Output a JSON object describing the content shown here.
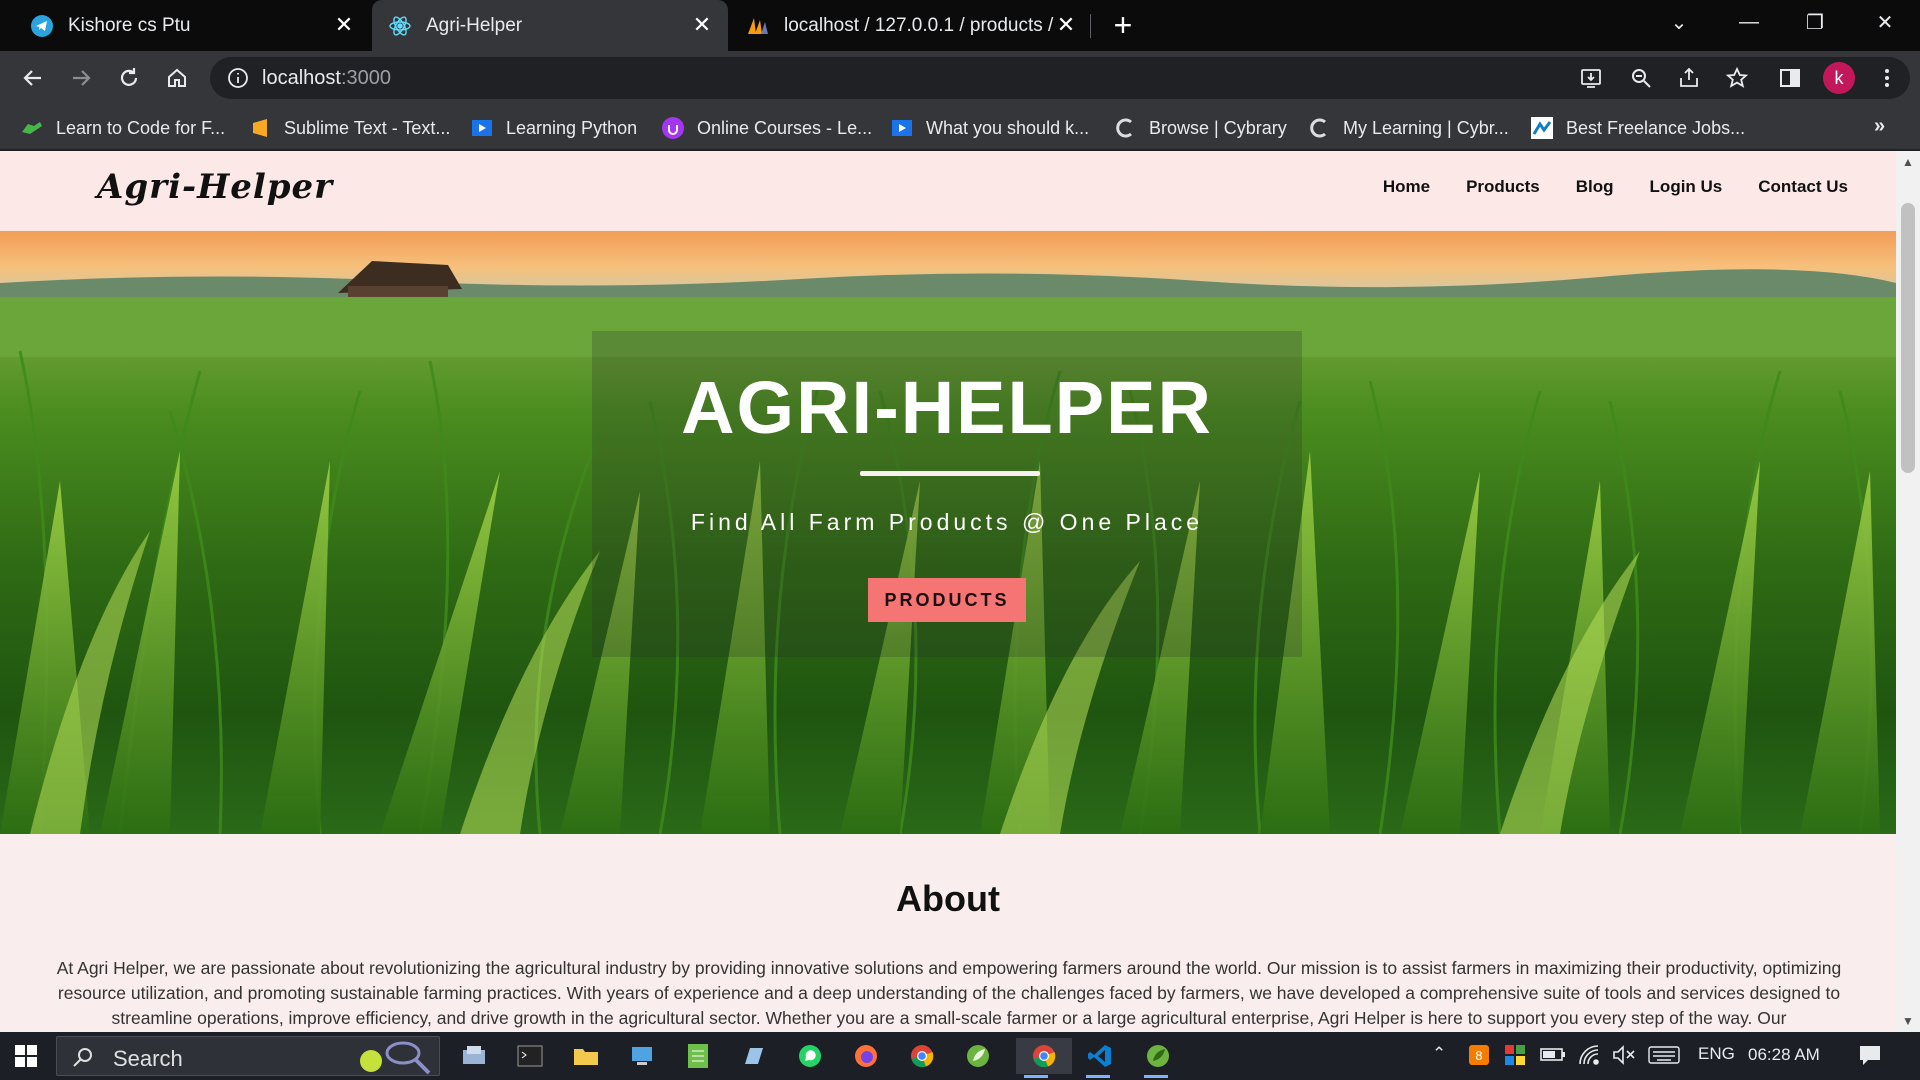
{
  "browser": {
    "tabs": [
      {
        "title": "Kishore cs Ptu",
        "icon": "telegram-icon",
        "active": false
      },
      {
        "title": "Agri-Helper",
        "icon": "react-icon",
        "active": true
      },
      {
        "title": "localhost / 127.0.0.1 / products /",
        "icon": "phpmyadmin-icon",
        "active": false
      }
    ],
    "url_host": "localhost",
    "url_port": ":3000",
    "profile_initial": "k",
    "bookmarks": [
      {
        "label": "Learn to Code for F...",
        "icon": "dino-icon"
      },
      {
        "label": "Sublime Text - Text...",
        "icon": "sublime-icon"
      },
      {
        "label": "Learning Python",
        "icon": "video-icon"
      },
      {
        "label": "Online Courses - Le...",
        "icon": "udemy-icon"
      },
      {
        "label": "What you should k...",
        "icon": "video-icon"
      },
      {
        "label": "Browse | Cybrary",
        "icon": "cybrary-icon"
      },
      {
        "label": "My Learning | Cybr...",
        "icon": "cybrary-icon"
      },
      {
        "label": "Best Freelance Jobs...",
        "icon": "freelancer-icon"
      }
    ],
    "more_bookmarks": "»"
  },
  "site": {
    "logo": "Agri-Helper",
    "nav": [
      "Home",
      "Products",
      "Blog",
      "Login Us",
      "Contact Us"
    ],
    "hero": {
      "title": "AGRI-HELPER",
      "subtitle": "Find All Farm Products @ One Place",
      "button": "PRODUCTS"
    },
    "about": {
      "heading": "About",
      "text": "At Agri Helper, we are passionate about revolutionizing the agricultural industry by providing innovative solutions and empowering farmers around the world. Our mission is to assist farmers in maximizing their productivity, optimizing resource utilization, and promoting sustainable farming practices. With years of experience and a deep understanding of the challenges faced by farmers, we have developed a comprehensive suite of tools and services designed to streamline operations, improve efficiency, and drive growth in the agricultural sector. Whether you are a small-scale farmer or a large agricultural enterprise, Agri Helper is here to support you every step of the way. Our"
    }
  },
  "taskbar": {
    "search_placeholder": "Search",
    "language": "ENG",
    "time": "06:28 AM"
  },
  "colors": {
    "button_bg": "#f57474",
    "navbar_bg": "#fde8e8",
    "page_bg": "#f9eded"
  }
}
